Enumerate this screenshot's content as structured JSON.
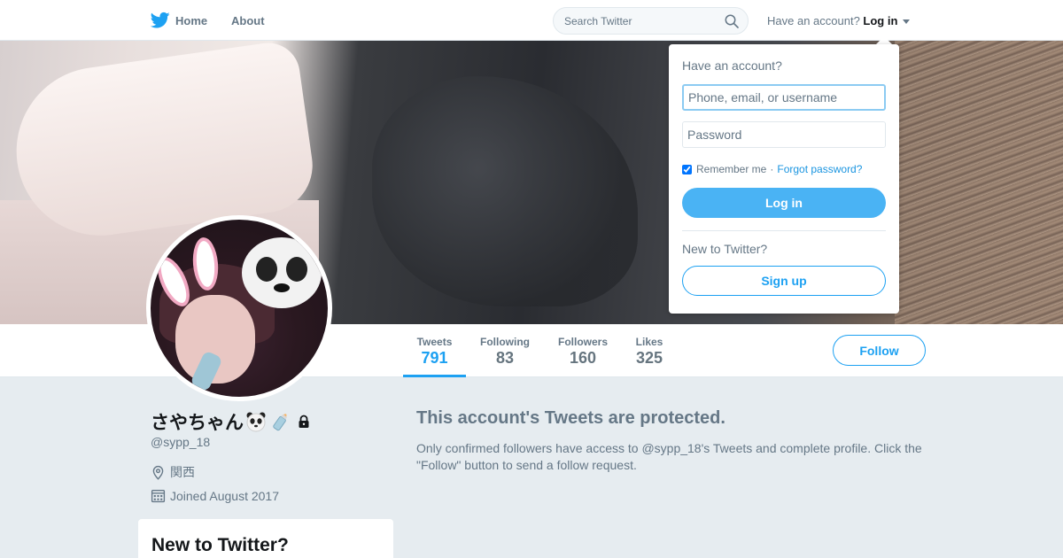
{
  "nav": {
    "home_label": "Home",
    "about_label": "About",
    "search_placeholder": "Search Twitter",
    "have_account_text": "Have an account?",
    "login_label": "Log in"
  },
  "profile": {
    "display_name": "さやちゃん",
    "handle": "@sypp_18",
    "location": "関西",
    "joined": "Joined August 2017",
    "name_emojis": [
      "panda-face",
      "baby-bottle",
      "lock"
    ]
  },
  "stats": [
    {
      "label": "Tweets",
      "value": "791",
      "active": true
    },
    {
      "label": "Following",
      "value": "83",
      "active": false
    },
    {
      "label": "Followers",
      "value": "160",
      "active": false
    },
    {
      "label": "Likes",
      "value": "325",
      "active": false
    }
  ],
  "follow_button_label": "Follow",
  "protected": {
    "title": "This account's Tweets are protected.",
    "message": "Only confirmed followers have access to @sypp_18's Tweets and complete profile. Click the \"Follow\" button to send a follow request."
  },
  "sidebar_card": {
    "title": "New to Twitter?"
  },
  "login_dropdown": {
    "heading": "Have an account?",
    "username_placeholder": "Phone, email, or username",
    "password_placeholder": "Password",
    "remember_label": "Remember me",
    "separator": "·",
    "forgot_label": "Forgot password?",
    "remember_checked": true,
    "login_button": "Log in",
    "new_heading": "New to Twitter?",
    "signup_button": "Sign up"
  },
  "colors": {
    "accent": "#1da1f2",
    "login_button_bg": "#4ab3f4",
    "secondary_text": "#657786",
    "page_bg": "#e6ecf0"
  },
  "icons": [
    "twitter-bird-icon",
    "search-icon",
    "caret-down-icon",
    "location-icon",
    "calendar-icon",
    "lock-icon"
  ]
}
